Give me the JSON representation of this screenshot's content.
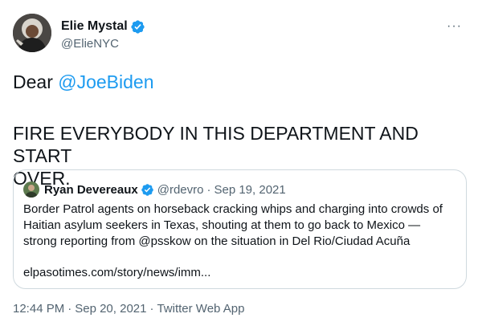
{
  "author": {
    "display_name": "Elie Mystal",
    "handle": "@ElieNYC"
  },
  "more_label": "···",
  "tweet": {
    "prefix": "Dear ",
    "mention": "@JoeBiden",
    "line2": "FIRE EVERYBODY IN THIS DEPARTMENT AND START",
    "line3": "OVER."
  },
  "quoted": {
    "display_name": "Ryan Devereaux",
    "handle": "@rdevro",
    "separator": "·",
    "date": "Sep 19, 2021",
    "lines": [
      "Border Patrol agents on horseback cracking whips and charging into crowds of",
      "Haitian asylum seekers in Texas, shouting at them to go back to Mexico —",
      "strong reporting from @psskow on the situation in Del Rio/Ciudad Acuña"
    ],
    "link": "elpasotimes.com/story/news/imm..."
  },
  "footer": {
    "time": "12:44 PM",
    "separator": "·",
    "date": "Sep 20, 2021",
    "separator2": "·",
    "source": "Twitter Web App"
  },
  "colors": {
    "link_blue": "#1d9bf0",
    "secondary_text": "#536471",
    "border": "#cfd9de"
  },
  "icons": {
    "verified": "verified-badge-icon",
    "more": "more-options-icon"
  }
}
